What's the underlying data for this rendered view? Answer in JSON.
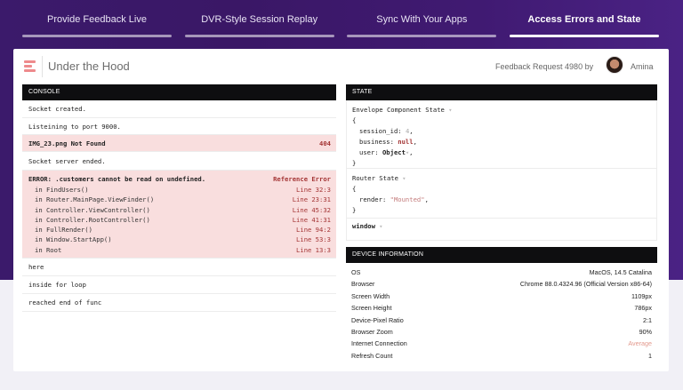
{
  "tabs": [
    {
      "label": "Provide Feedback Live",
      "active": false
    },
    {
      "label": "DVR-Style Session Replay",
      "active": false
    },
    {
      "label": "Sync With Your Apps",
      "active": false
    },
    {
      "label": "Access Errors and State",
      "active": true
    }
  ],
  "header": {
    "title": "Under the Hood",
    "request": "Feedback Request 4980 by",
    "user": "Amina"
  },
  "console": {
    "heading": "CONSOLE",
    "rows_top": [
      "Socket created.",
      "Listeining to port 9000."
    ],
    "error_row": {
      "text": "IMG_23.png Not Found",
      "code": "404"
    },
    "row_mid": "Socket server ended.",
    "error_block": {
      "message": "ERROR: .customers cannot be read on undefined.",
      "type": "Reference Error",
      "trace": [
        {
          "fn": "in FindUsers()",
          "line": "Line 32:3"
        },
        {
          "fn": "in Router.MainPage.ViewFinder()",
          "line": "Line 23:31"
        },
        {
          "fn": "in Controller.ViewController()",
          "line": "Line 45:32"
        },
        {
          "fn": "in Controller.RootController()",
          "line": "Line 41:31"
        },
        {
          "fn": "in FullRender()",
          "line": "Line 94:2"
        },
        {
          "fn": "in Window.StartApp()",
          "line": "Line 53:3"
        },
        {
          "fn": "in Root",
          "line": "Line 13:3"
        }
      ]
    },
    "rows_bottom": [
      "here",
      "inside for loop",
      "reached end of func"
    ]
  },
  "state": {
    "heading": "STATE",
    "envelope": {
      "name": "Envelope Component State",
      "open": "{",
      "k1": "session_id:",
      "v1": "4",
      "k2": "business:",
      "v2": "null",
      "k3": "user:",
      "v3": "Object",
      "close": "}"
    },
    "router": {
      "name": "Router State",
      "open": "{",
      "k1": "render:",
      "v1": "\"Mounted\"",
      "close": "}"
    },
    "window_label": "window"
  },
  "device": {
    "heading": "DEVICE INFORMATION",
    "rows": [
      {
        "label": "OS",
        "value": "MacOS, 14.5 Catalina"
      },
      {
        "label": "Browser",
        "value": "Chrome 88.0.4324.96 (Official Version x86-64)"
      },
      {
        "label": "Screen Width",
        "value": "1109px"
      },
      {
        "label": "Screen Height",
        "value": "786px"
      },
      {
        "label": "Device-Pixel Ratio",
        "value": "2:1"
      },
      {
        "label": "Browser Zoom",
        "value": "90%"
      },
      {
        "label": "Internet Connection",
        "value": "Average"
      },
      {
        "label": "Refresh Count",
        "value": "1"
      }
    ]
  },
  "colors": {
    "purple_bg": "#3b1a6b",
    "error_bg": "#f9dede",
    "error_text": "#a43535",
    "logo_accent": "#ee8a8c"
  },
  "icons": {
    "logo": "stacked-lines-logo-icon",
    "expand": "caret-down-icon"
  }
}
